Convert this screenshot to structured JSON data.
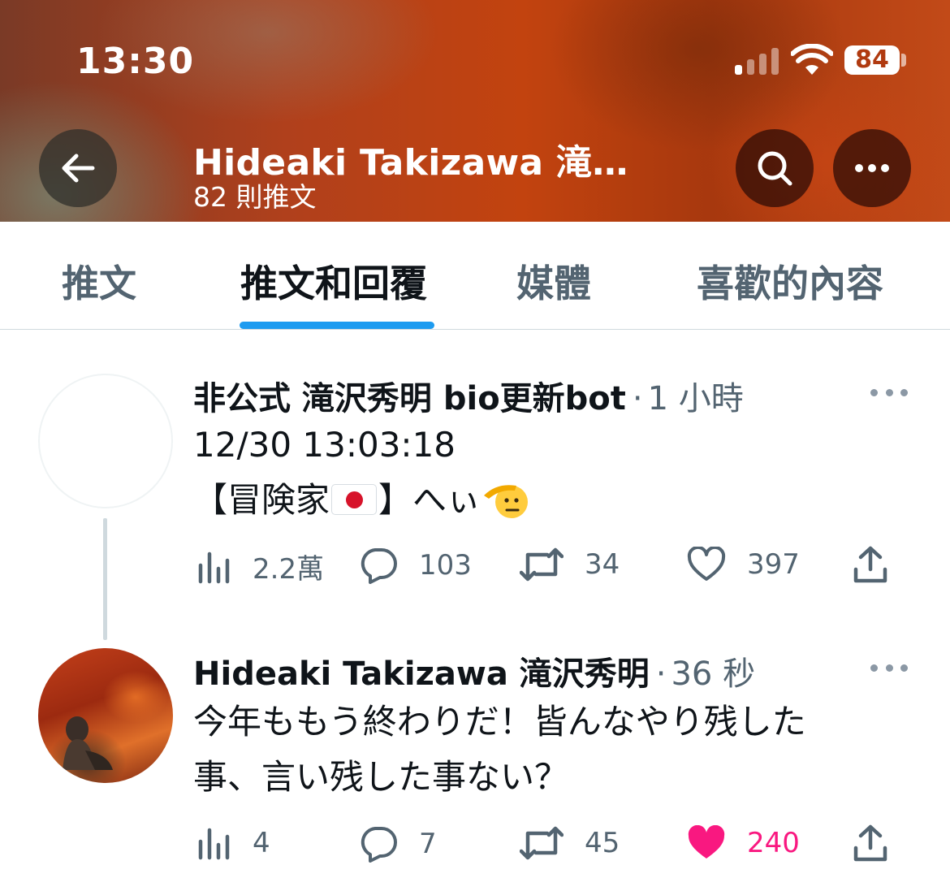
{
  "status_bar": {
    "time": "13:30",
    "battery": "84"
  },
  "header": {
    "profile_name": "Hideaki Takizawa 滝…",
    "post_count": "82 則推文"
  },
  "tabs": [
    {
      "label": "推文"
    },
    {
      "label": "推文和回覆"
    },
    {
      "label": "媒體"
    },
    {
      "label": "喜歡的內容"
    }
  ],
  "tweets": [
    {
      "author": "非公式 滝沢秀明 bio更新bot",
      "separator": "·",
      "time": "1 小時",
      "line1": "12/30 13:03:18",
      "line2_prefix": "【冒険家",
      "line2_mid": "】へぃ",
      "views": "2.2萬",
      "replies": "103",
      "retweets": "34",
      "likes": "397"
    },
    {
      "author": "Hideaki Takizawa 滝沢秀明",
      "separator": "·",
      "time": "36 秒",
      "line1": "今年ももう終わりだ！皆んなやり残した",
      "line2": "事、言い残した事ない？",
      "views": "4",
      "replies": "7",
      "retweets": "45",
      "likes": "240"
    }
  ],
  "colors": {
    "accent": "#1d9bf0",
    "like": "#f91880",
    "muted": "#536471"
  }
}
